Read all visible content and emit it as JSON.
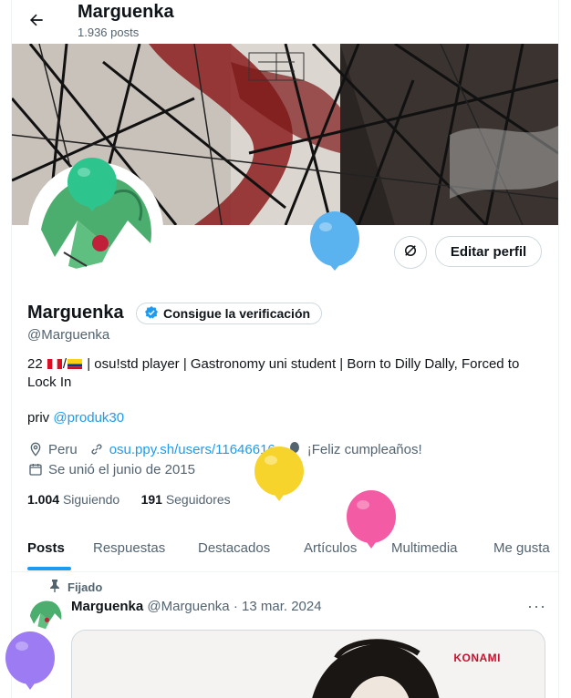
{
  "header": {
    "name": "Marguenka",
    "post_count": "1.936 posts"
  },
  "actions": {
    "edit_profile": "Editar perfil"
  },
  "profile": {
    "name": "Marguenka",
    "verify_badge": "Consigue la verificación",
    "handle": "@Marguenka",
    "bio_prefix": "22",
    "bio_text": "| osu!std player | Gastronomy uni student | Born to Dilly Dally, Forced to Lock In",
    "bio_priv": "priv",
    "bio_mention": "@produk30",
    "location": "Peru",
    "website": "osu.ppy.sh/users/11646616",
    "birthday": "¡Feliz cumpleaños!",
    "joined": "Se unió el junio de 2015",
    "following_count": "1.004",
    "following_label": "Siguiendo",
    "followers_count": "191",
    "followers_label": "Seguidores"
  },
  "tabs": [
    "Posts",
    "Respuestas",
    "Destacados",
    "Artículos",
    "Multimedia",
    "Me gusta"
  ],
  "active_tab": "Posts",
  "post": {
    "pinned_label": "Fijado",
    "author": "Marguenka",
    "handle": "@Marguenka",
    "separator": "·",
    "date": "13 mar. 2024",
    "more": "···",
    "media_brand": "KONAMI"
  },
  "colors": {
    "accent": "#1d9bf0",
    "text": "#0f1419",
    "muted": "#536471",
    "border": "#cfd9de"
  },
  "balloons": [
    "green",
    "blue",
    "yellow",
    "pink",
    "purple"
  ]
}
